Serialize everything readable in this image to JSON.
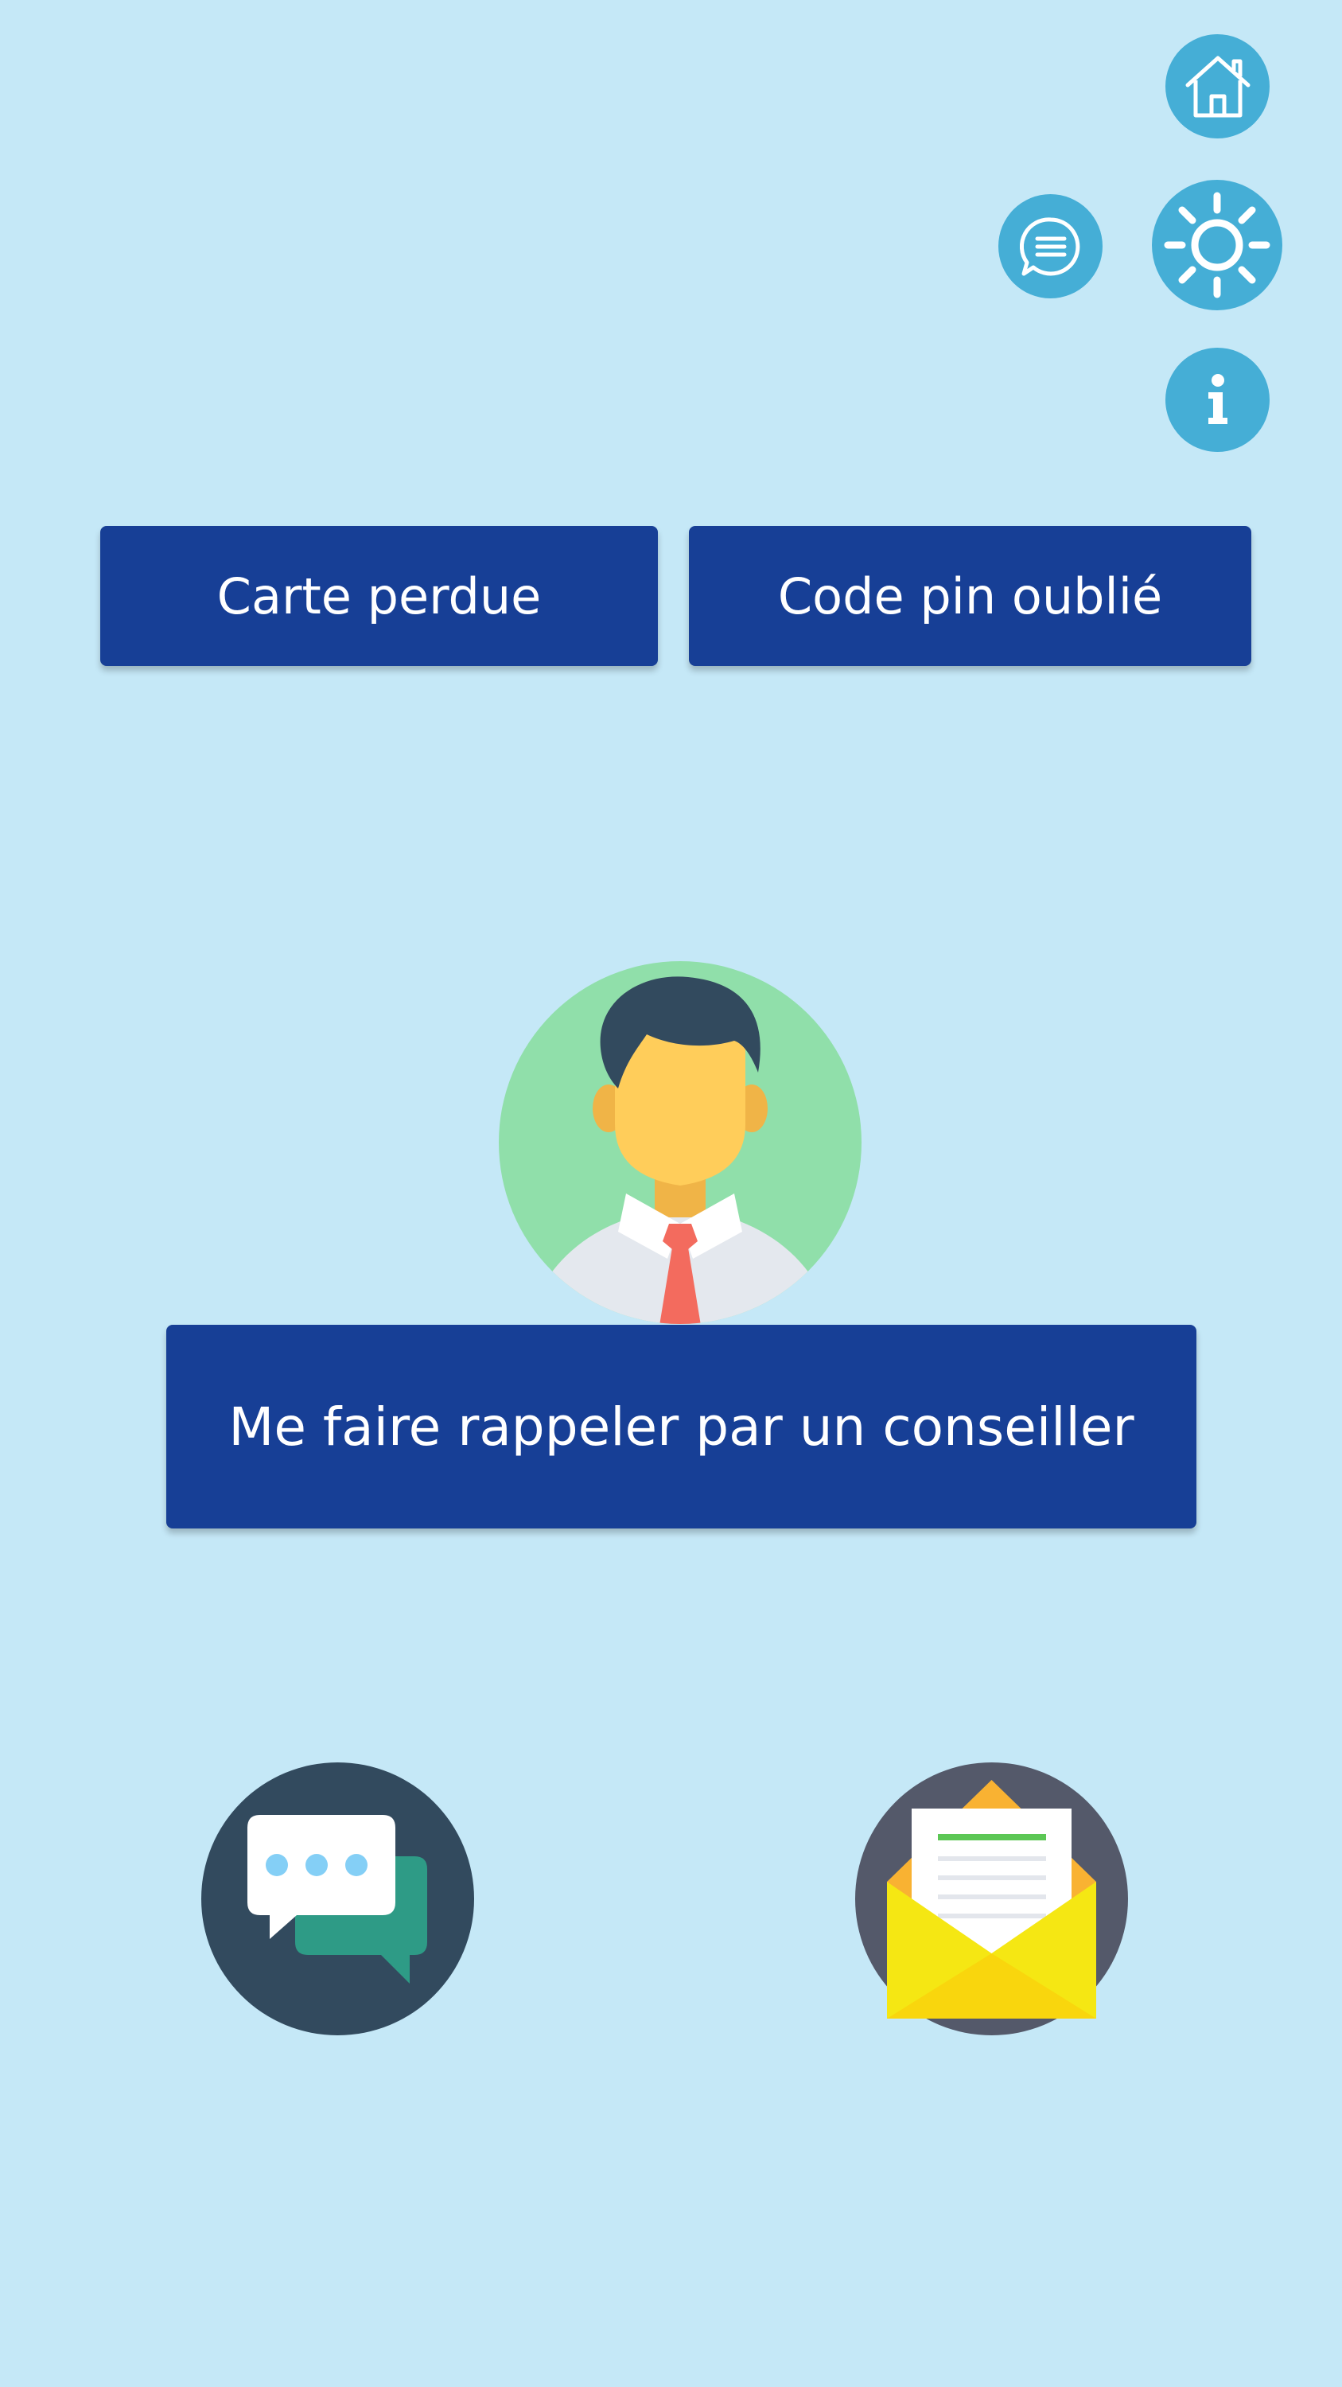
{
  "header": {
    "icons": {
      "home": "home-icon",
      "messages": "chat-bubble-icon",
      "brightness": "sun-icon",
      "info": "info-icon"
    }
  },
  "actions": {
    "lost_card_label": "Carte perdue",
    "forgot_pin_label": "Code pin oublié"
  },
  "advisor": {
    "avatar_icon": "advisor-avatar-icon",
    "callback_label": "Me faire rappeler par un conseiller"
  },
  "contact": {
    "chat_icon": "chat-icon",
    "mail_icon": "mail-envelope-icon"
  },
  "colors": {
    "background": "#c5e8f7",
    "primary_button": "#173f96",
    "round_icon": "#45aed6",
    "dark_circle": "#324a5e"
  }
}
